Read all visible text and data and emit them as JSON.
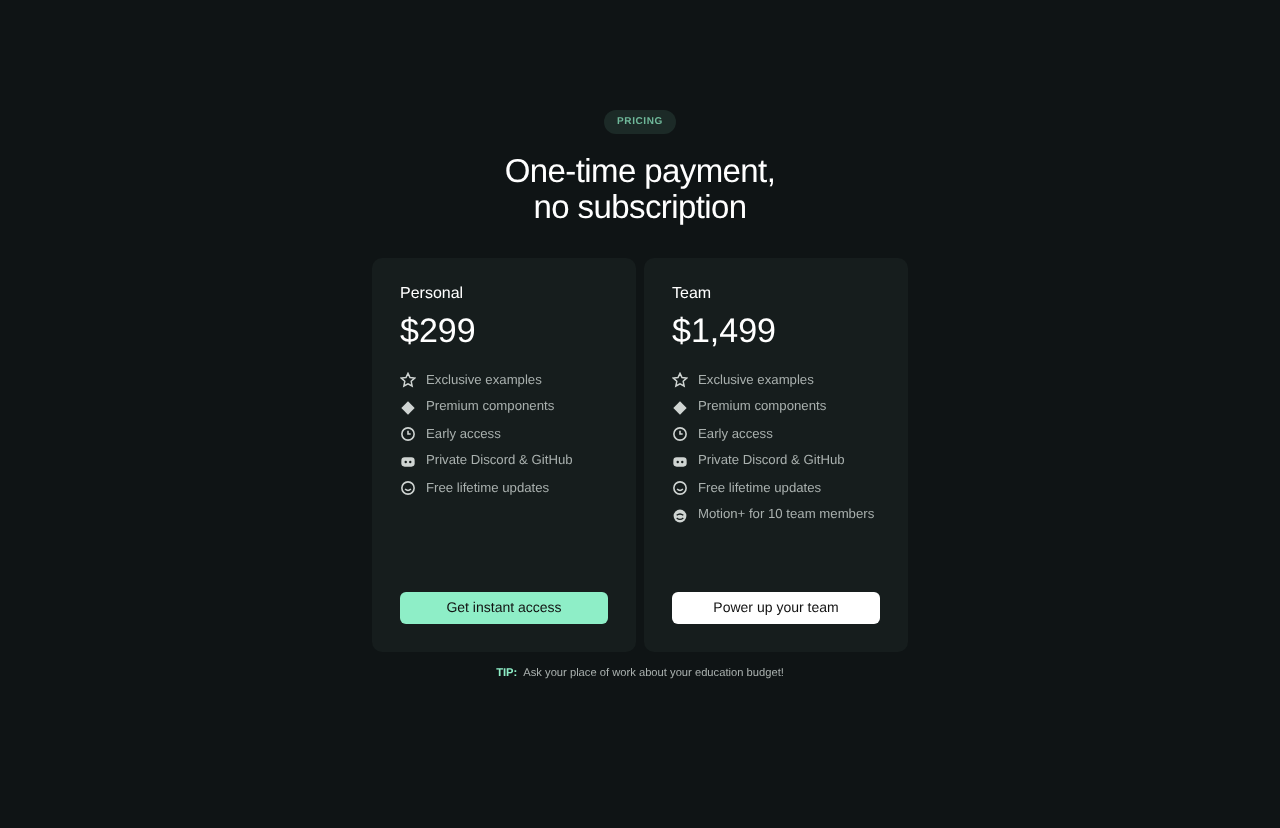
{
  "badge": "PRICING",
  "title": [
    "One-time payment,",
    "no subscription"
  ],
  "plans": [
    {
      "name": "Personal",
      "price": "$299",
      "features": [
        "Exclusive examples",
        "Premium components",
        "Early access",
        "Private Discord & GitHub",
        "Free lifetime updates"
      ],
      "button": {
        "label": "Get instant access",
        "kind": "primary"
      }
    },
    {
      "name": "Team",
      "price": "$1,499",
      "features": [
        "Exclusive examples",
        "Premium components",
        "Early access",
        "Private Discord & GitHub",
        "Free lifetime updates",
        "Motion+ for 10 team members"
      ],
      "button": {
        "label": "Power up your team",
        "kind": "secondary"
      }
    }
  ],
  "tip": {
    "label": "TIP:",
    "text": "Ask your place of work about your education budget!"
  }
}
